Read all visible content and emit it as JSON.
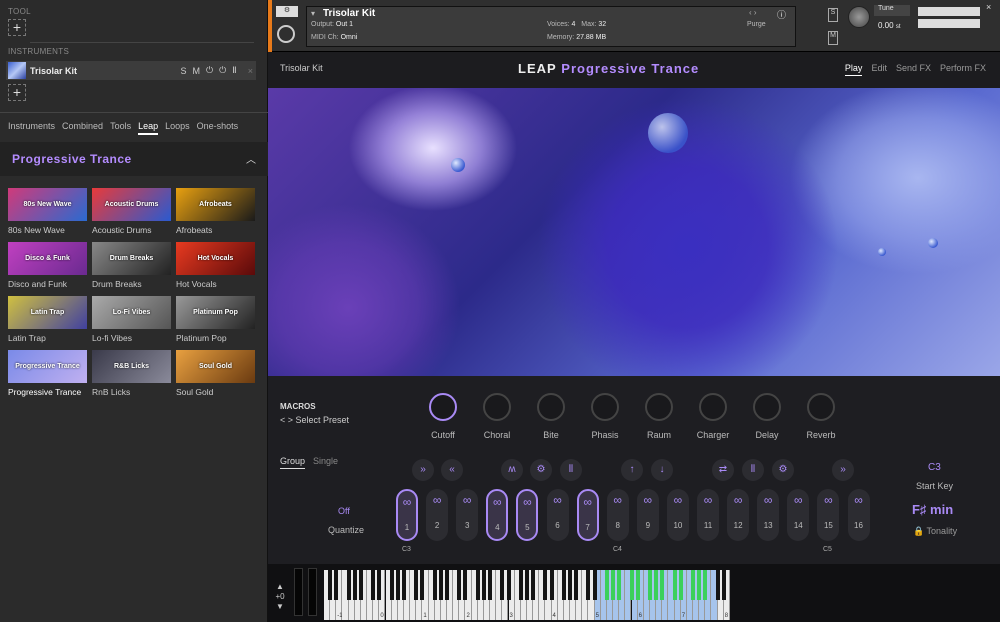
{
  "sidebar": {
    "tool_label": "TOOL",
    "instruments_label": "INSTRUMENTS",
    "instrument": {
      "name": "Trisolar Kit",
      "buttons": [
        "S",
        "M",
        "⏻",
        "⏻",
        "Ⅱ"
      ]
    },
    "tabs": [
      "Instruments",
      "Combined",
      "Tools",
      "Leap",
      "Loops",
      "One-shots"
    ],
    "active_tab": "Leap",
    "section_title": "Progressive Trance",
    "tiles": [
      {
        "label": "80s New Wave",
        "thumb": "80s New Wave",
        "c1": "#d03a7a",
        "c2": "#2a6ad0"
      },
      {
        "label": "Acoustic Drums",
        "thumb": "Acoustic Drums",
        "c1": "#e83a3a",
        "c2": "#2a5ad0"
      },
      {
        "label": "Afrobeats",
        "thumb": "Afrobeats",
        "c1": "#e8a010",
        "c2": "#1a1a1a"
      },
      {
        "label": "Disco and Funk",
        "thumb": "Disco & Funk",
        "c1": "#c040c0",
        "c2": "#6a2a90"
      },
      {
        "label": "Drum Breaks",
        "thumb": "Drum Breaks",
        "c1": "#888888",
        "c2": "#222222"
      },
      {
        "label": "Hot Vocals",
        "thumb": "Hot Vocals",
        "c1": "#e83a20",
        "c2": "#5a0a0a"
      },
      {
        "label": "Latin Trap",
        "thumb": "Latin Trap",
        "c1": "#d0c040",
        "c2": "#4040a0"
      },
      {
        "label": "Lo-fi Vibes",
        "thumb": "Lo-Fi Vibes",
        "c1": "#aaaaaa",
        "c2": "#555555"
      },
      {
        "label": "Platinum Pop",
        "thumb": "Platinum Pop",
        "c1": "#999999",
        "c2": "#222222"
      },
      {
        "label": "Progressive Trance",
        "thumb": "Progressive Trance",
        "c1": "#7a8ae8",
        "c2": "#c0b0f0",
        "selected": true
      },
      {
        "label": "RnB Licks",
        "thumb": "R&B Licks",
        "c1": "#3a3a4a",
        "c2": "#8a8a9a"
      },
      {
        "label": "Soul Gold",
        "thumb": "Soul Gold",
        "c1": "#e8a040",
        "c2": "#6a3a10"
      }
    ]
  },
  "kontakt": {
    "instrument_name": "Trisolar Kit",
    "output_label": "Output:",
    "output_value": "Out 1",
    "midi_label": "MIDI Ch:",
    "midi_value": "Omni",
    "voices_label": "Voices:",
    "voices_value": "4",
    "max_label": "Max:",
    "max_value": "32",
    "memory_label": "Memory:",
    "memory_value": "27.88 MB",
    "purge_label": "Purge",
    "tune_label": "Tune",
    "tune_value": "0.00",
    "tune_unit": "st"
  },
  "header": {
    "instrument": "Trisolar Kit",
    "brand": "LEAP",
    "product": "Progressive Trance",
    "nav": [
      "Play",
      "Edit",
      "Send FX",
      "Perform FX"
    ],
    "active_nav": "Play"
  },
  "macros": {
    "title": "MACROS",
    "preset": "Select Preset",
    "knobs": [
      "Cutoff",
      "Choral",
      "Bite",
      "Phasis",
      "Raum",
      "Charger",
      "Delay",
      "Reverb"
    ],
    "active_knob": "Cutoff"
  },
  "sequencer": {
    "modes": [
      "Group",
      "Single"
    ],
    "active_mode": "Group",
    "quantize_value": "Off",
    "quantize_label": "Quantize",
    "fx_icons": [
      "»",
      "«",
      "ʍ",
      "⚙",
      "⦀",
      "↑",
      "↓",
      "⇄",
      "⦀",
      "⚙",
      "»"
    ],
    "pads": [
      "1",
      "2",
      "3",
      "4",
      "5",
      "6",
      "7",
      "8",
      "9",
      "10",
      "11",
      "12",
      "13",
      "14",
      "15",
      "16"
    ],
    "active_pads": [
      0,
      3,
      4,
      6
    ],
    "notes": [
      "C3",
      "C4",
      "C5"
    ],
    "start_key_value": "C3",
    "start_key_label": "Start Key",
    "key": "F♯ min",
    "tonality_label": "Tonality"
  },
  "keyboard": {
    "octave": "+0",
    "octave_labels": [
      "-1",
      "0",
      "1",
      "2",
      "3",
      "4",
      "5",
      "6",
      "7",
      "8"
    ]
  }
}
